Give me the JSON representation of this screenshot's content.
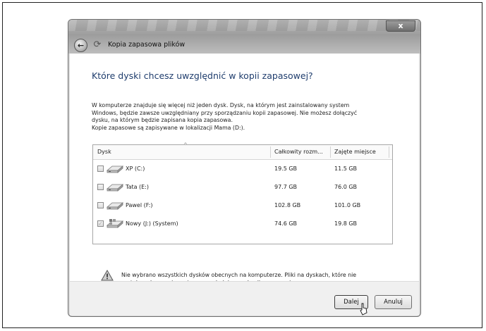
{
  "window": {
    "title": "Kopia zapasowa plików",
    "close_glyph": "x",
    "back_glyph": "←"
  },
  "dialog": {
    "heading": "Które dyski chcesz uwzględnić w kopii zapasowej?",
    "description_lines": [
      "W komputerze znajduje się więcej niż jeden dysk. Dysk, na którym jest zainstalowany system",
      "Windows, będzie zawsze uwzględniany przy sporządzaniu kopii zapasowej. Nie możesz dołączyć",
      "dysku, na którym będzie zapisana kopia zapasowa.",
      "Kopie zapasowe są zapisywane w lokalizacji Mama (D:)."
    ]
  },
  "table": {
    "columns": [
      "Dysk",
      "Całkowity rozm...",
      "Zajęte miejsce"
    ],
    "rows": [
      {
        "name": "XP (C:)",
        "total": "19.5 GB",
        "used": "11.5 GB",
        "checked": false,
        "icon": "drive-icon"
      },
      {
        "name": "Tata (E:)",
        "total": "97.7 GB",
        "used": "76.0 GB",
        "checked": false,
        "icon": "drive-icon"
      },
      {
        "name": "Pawel (F:)",
        "total": "102.8 GB",
        "used": "101.0 GB",
        "checked": false,
        "icon": "drive-icon"
      },
      {
        "name": "Nowy (J:) (System)",
        "total": "74.6 GB",
        "used": "19.8 GB",
        "checked": true,
        "icon": "system-drive-icon"
      }
    ]
  },
  "warning": {
    "icon": "warning-icon",
    "lines": [
      "Nie wybrano wszystkich dysków obecnych na komputerze. Pliki na dyskach, które nie",
      "zostały wybrane nie zostaną uwzględnione w kopii zapasowej."
    ]
  },
  "buttons": {
    "next": "Dalej",
    "cancel": "Anuluj"
  }
}
